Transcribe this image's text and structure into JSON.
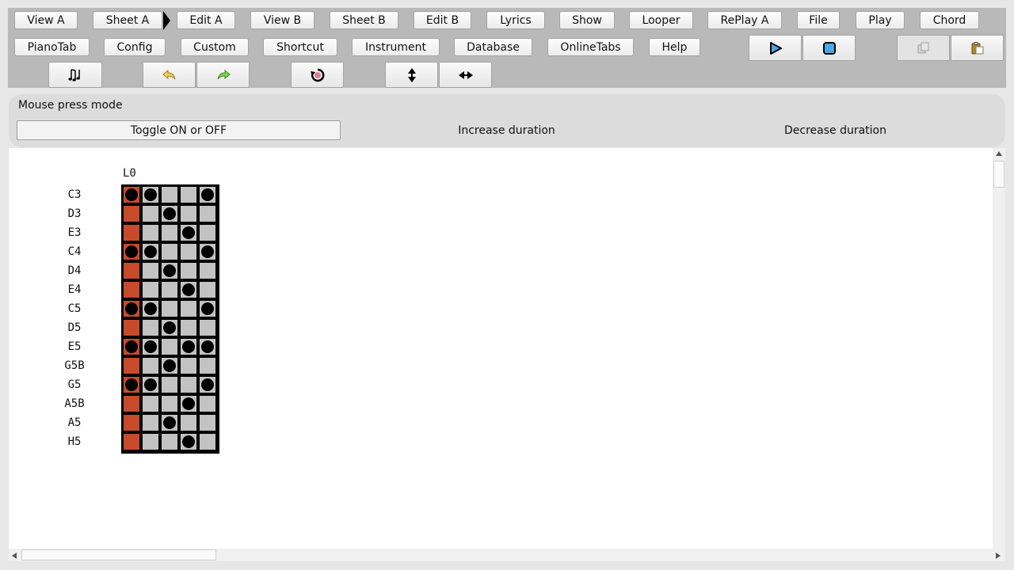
{
  "toolbar": {
    "row1": [
      "View A",
      "Sheet A",
      "Edit A",
      "View B",
      "Sheet B",
      "Edit B",
      "Lyrics",
      "Show",
      "Looper",
      "RePlay A",
      "File",
      "Play",
      "Chord"
    ],
    "row2": [
      "PianoTab",
      "Config",
      "Custom",
      "Shortcut",
      "Instrument",
      "Database",
      "OnlineTabs",
      "Help"
    ],
    "icons": [
      "notes-icon",
      "undo-icon",
      "redo-icon",
      "refresh-icon",
      "vertical-resize-icon",
      "horizontal-resize-icon",
      "play-icon",
      "stop-icon",
      "copy-icon",
      "paste-icon"
    ]
  },
  "mode_panel": {
    "title": "Mouse press mode",
    "options": [
      "Toggle ON or OFF",
      "Increase duration",
      "Decrease duration"
    ],
    "selected": "Toggle ON or OFF"
  },
  "sheet": {
    "column_header": "L0",
    "notes": [
      "C3",
      "D3",
      "E3",
      "C4",
      "D4",
      "E4",
      "C5",
      "D5",
      "E5",
      "G5B",
      "G5",
      "A5B",
      "A5",
      "H5"
    ],
    "dots": [
      [
        0,
        1,
        4
      ],
      [
        2
      ],
      [
        3
      ],
      [
        0,
        1,
        4
      ],
      [
        2
      ],
      [
        3
      ],
      [
        0,
        1,
        4
      ],
      [
        2
      ],
      [
        0,
        1,
        3,
        4
      ],
      [
        2
      ],
      [
        0,
        1,
        4
      ],
      [
        3
      ],
      [
        2
      ],
      [
        3
      ]
    ]
  },
  "colors": {
    "first_column": "#c74b2a",
    "cell": "#c3c3c3",
    "accent": "#4aa8e8"
  }
}
